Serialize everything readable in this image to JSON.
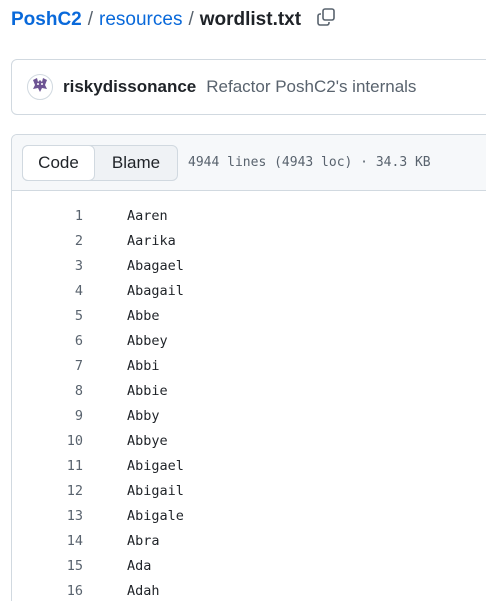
{
  "breadcrumb": {
    "repo": "PoshC2",
    "separator": "/",
    "dir": "resources",
    "file": "wordlist.txt"
  },
  "icons": {
    "copy": "copy-icon",
    "avatar": "avatar-icon"
  },
  "commit": {
    "author": "riskydissonance",
    "message": "Refactor PoshC2's internals"
  },
  "file_header": {
    "tabs": [
      "Code",
      "Blame"
    ],
    "active_tab": "Code",
    "info": "4944 lines (4943 loc) · 34.3 KB"
  },
  "lines": [
    {
      "n": "1",
      "t": "Aaren"
    },
    {
      "n": "2",
      "t": "Aarika"
    },
    {
      "n": "3",
      "t": "Abagael"
    },
    {
      "n": "4",
      "t": "Abagail"
    },
    {
      "n": "5",
      "t": "Abbe"
    },
    {
      "n": "6",
      "t": "Abbey"
    },
    {
      "n": "7",
      "t": "Abbi"
    },
    {
      "n": "8",
      "t": "Abbie"
    },
    {
      "n": "9",
      "t": "Abby"
    },
    {
      "n": "10",
      "t": "Abbye"
    },
    {
      "n": "11",
      "t": "Abigael"
    },
    {
      "n": "12",
      "t": "Abigail"
    },
    {
      "n": "13",
      "t": "Abigale"
    },
    {
      "n": "14",
      "t": "Abra"
    },
    {
      "n": "15",
      "t": "Ada"
    },
    {
      "n": "16",
      "t": "Adah"
    }
  ]
}
